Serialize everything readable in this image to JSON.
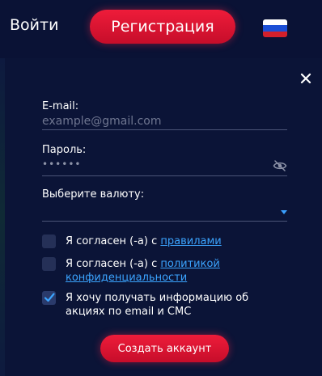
{
  "header": {
    "login_label": "Войти",
    "register_label": "Регистрация",
    "language_flag": "russia-flag-icon"
  },
  "form": {
    "email": {
      "label": "E-mail:",
      "placeholder": "example@gmail.com"
    },
    "password": {
      "label": "Пароль:",
      "masked_value": "••••••"
    },
    "currency": {
      "label": "Выберите валюту:",
      "value": ""
    },
    "agreements": [
      {
        "checked": false,
        "text": "Я согласен (-а) с ",
        "link_text": "правилами"
      },
      {
        "checked": false,
        "text": "Я согласен (-а) с ",
        "link_text": "политикой конфиденциальности"
      },
      {
        "checked": true,
        "text": "Я хочу получать информацию об акциях по email и СМС",
        "link_text": ""
      }
    ],
    "submit_label": "Создать аккаунт"
  },
  "colors": {
    "background": "#0b1437",
    "accent_red": "#e0153a",
    "link_blue": "#3ba4ff"
  }
}
